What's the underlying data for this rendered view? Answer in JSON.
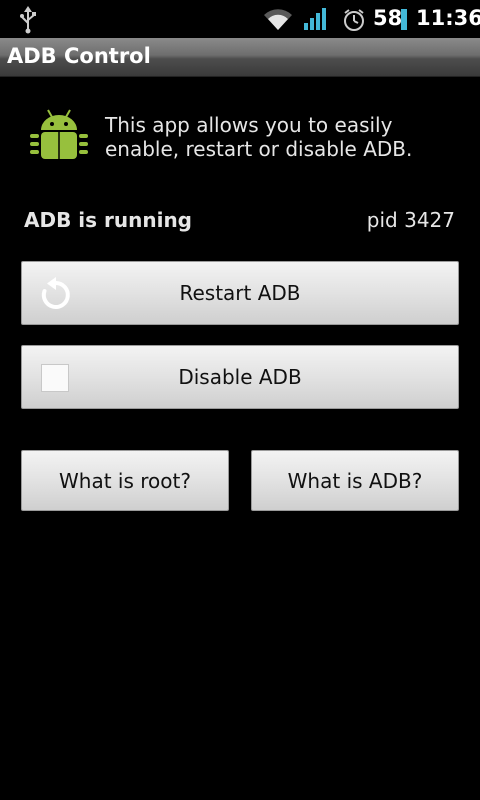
{
  "status_bar": {
    "battery": "58",
    "time": "11:36",
    "icons": [
      "usb-icon",
      "wifi-icon",
      "signal-icon",
      "alarm-icon",
      "battery-icon"
    ]
  },
  "app": {
    "title": "ADB Control"
  },
  "intro": {
    "text": "This app allows you to easily enable, restart or disable ADB."
  },
  "status": {
    "label": "ADB is running",
    "pid": "pid 3427"
  },
  "buttons": {
    "restart": "Restart ADB",
    "disable": "Disable ADB",
    "what_is_root": "What is root?",
    "what_is_adb": "What is ADB?"
  },
  "colors": {
    "android_green": "#97c03d",
    "battery_accent": "#43b8d8"
  }
}
